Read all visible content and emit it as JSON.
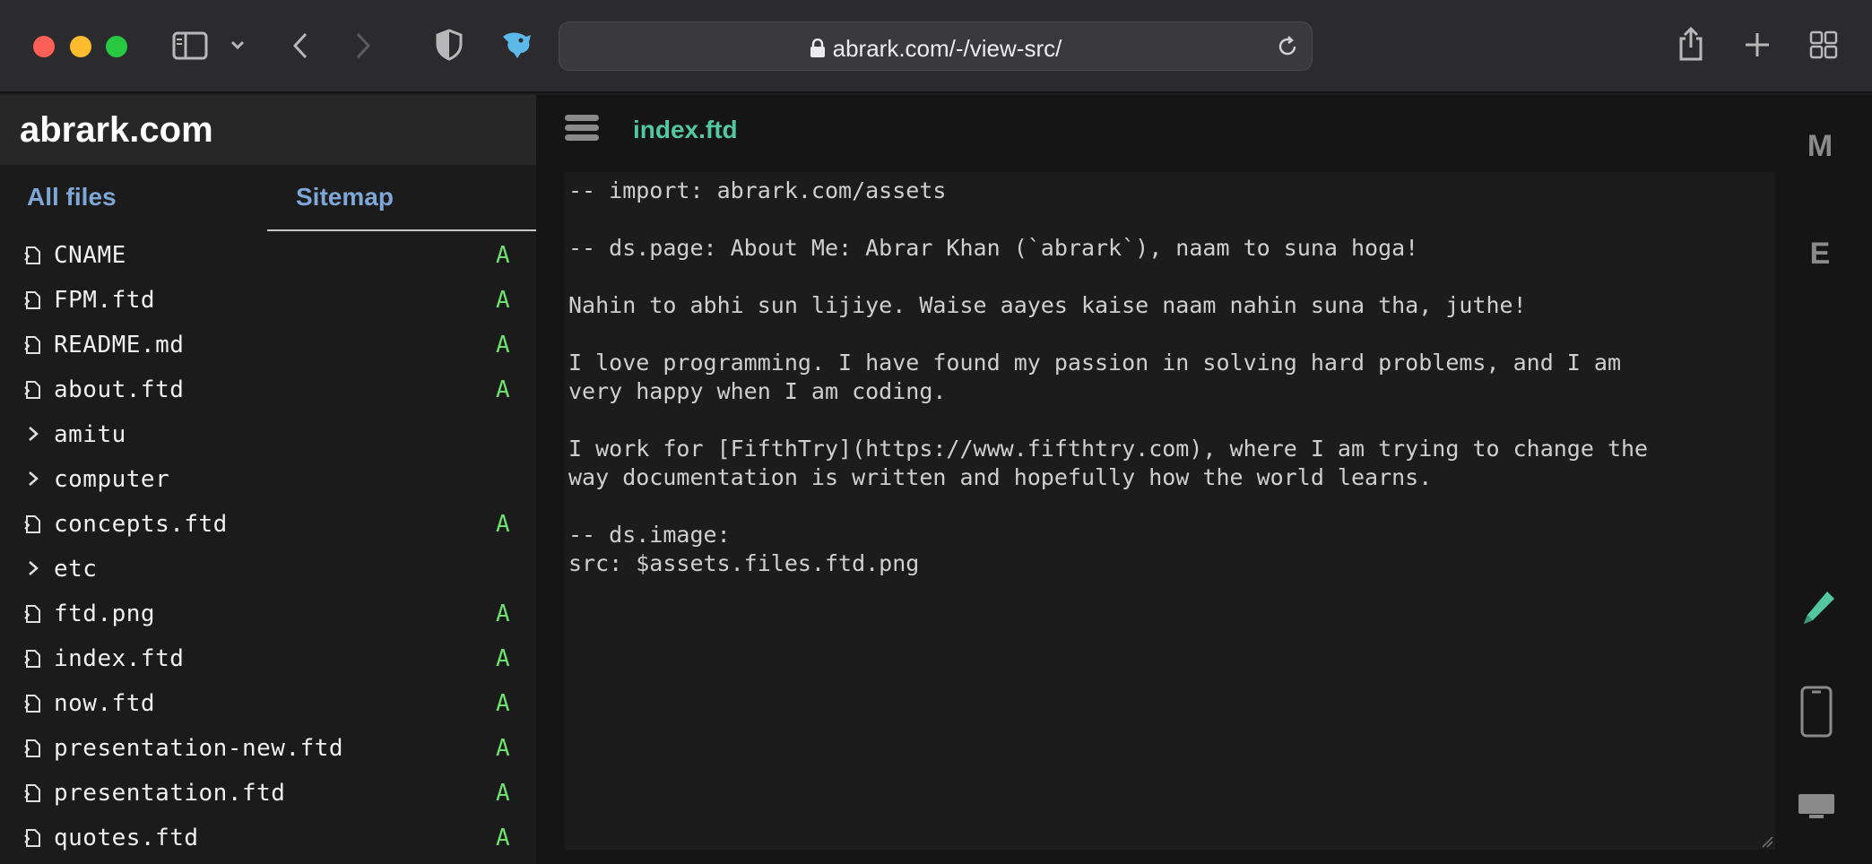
{
  "browser": {
    "url": "abrark.com/-/view-src/"
  },
  "sidebar": {
    "site_title": "abrark.com",
    "tabs": {
      "all_files": "All files",
      "sitemap": "Sitemap"
    },
    "files": [
      {
        "name": "CNAME",
        "kind": "file",
        "status": "A"
      },
      {
        "name": "FPM.ftd",
        "kind": "file",
        "status": "A"
      },
      {
        "name": "README.md",
        "kind": "file",
        "status": "A"
      },
      {
        "name": "about.ftd",
        "kind": "file",
        "status": "A"
      },
      {
        "name": "amitu",
        "kind": "folder",
        "status": ""
      },
      {
        "name": "computer",
        "kind": "folder",
        "status": ""
      },
      {
        "name": "concepts.ftd",
        "kind": "file",
        "status": "A"
      },
      {
        "name": "etc",
        "kind": "folder",
        "status": ""
      },
      {
        "name": "ftd.png",
        "kind": "file",
        "status": "A"
      },
      {
        "name": "index.ftd",
        "kind": "file",
        "status": "A"
      },
      {
        "name": "now.ftd",
        "kind": "file",
        "status": "A"
      },
      {
        "name": "presentation-new.ftd",
        "kind": "file",
        "status": "A"
      },
      {
        "name": "presentation.ftd",
        "kind": "file",
        "status": "A"
      },
      {
        "name": "quotes.ftd",
        "kind": "file",
        "status": "A"
      }
    ]
  },
  "main": {
    "file_title": "index.ftd",
    "code_lines": [
      "-- import: abrark.com/assets",
      "",
      "-- ds.page: About Me: Abrar Khan (`abrark`), naam to suna hoga!",
      "",
      "Nahin to abhi sun lijiye. Waise aayes kaise naam nahin suna tha, juthe!",
      "",
      "I love programming. I have found my passion in solving hard problems, and I am",
      "very happy when I am coding.",
      "",
      "I work for [FifthTry](https://www.fifthtry.com), where I am trying to change the",
      "way documentation is written and hopefully how the world learns.",
      "",
      "-- ds.image:",
      "src: $assets.files.ftd.png"
    ]
  },
  "rail": {
    "m_label": "M",
    "e_label": "E",
    "icons": [
      "pencil-icon",
      "mobile-icon",
      "desktop-icon"
    ]
  },
  "colors": {
    "accent_green": "#52c7a0",
    "status_green": "#6ee06e",
    "tab_blue": "#7ea6d6"
  }
}
